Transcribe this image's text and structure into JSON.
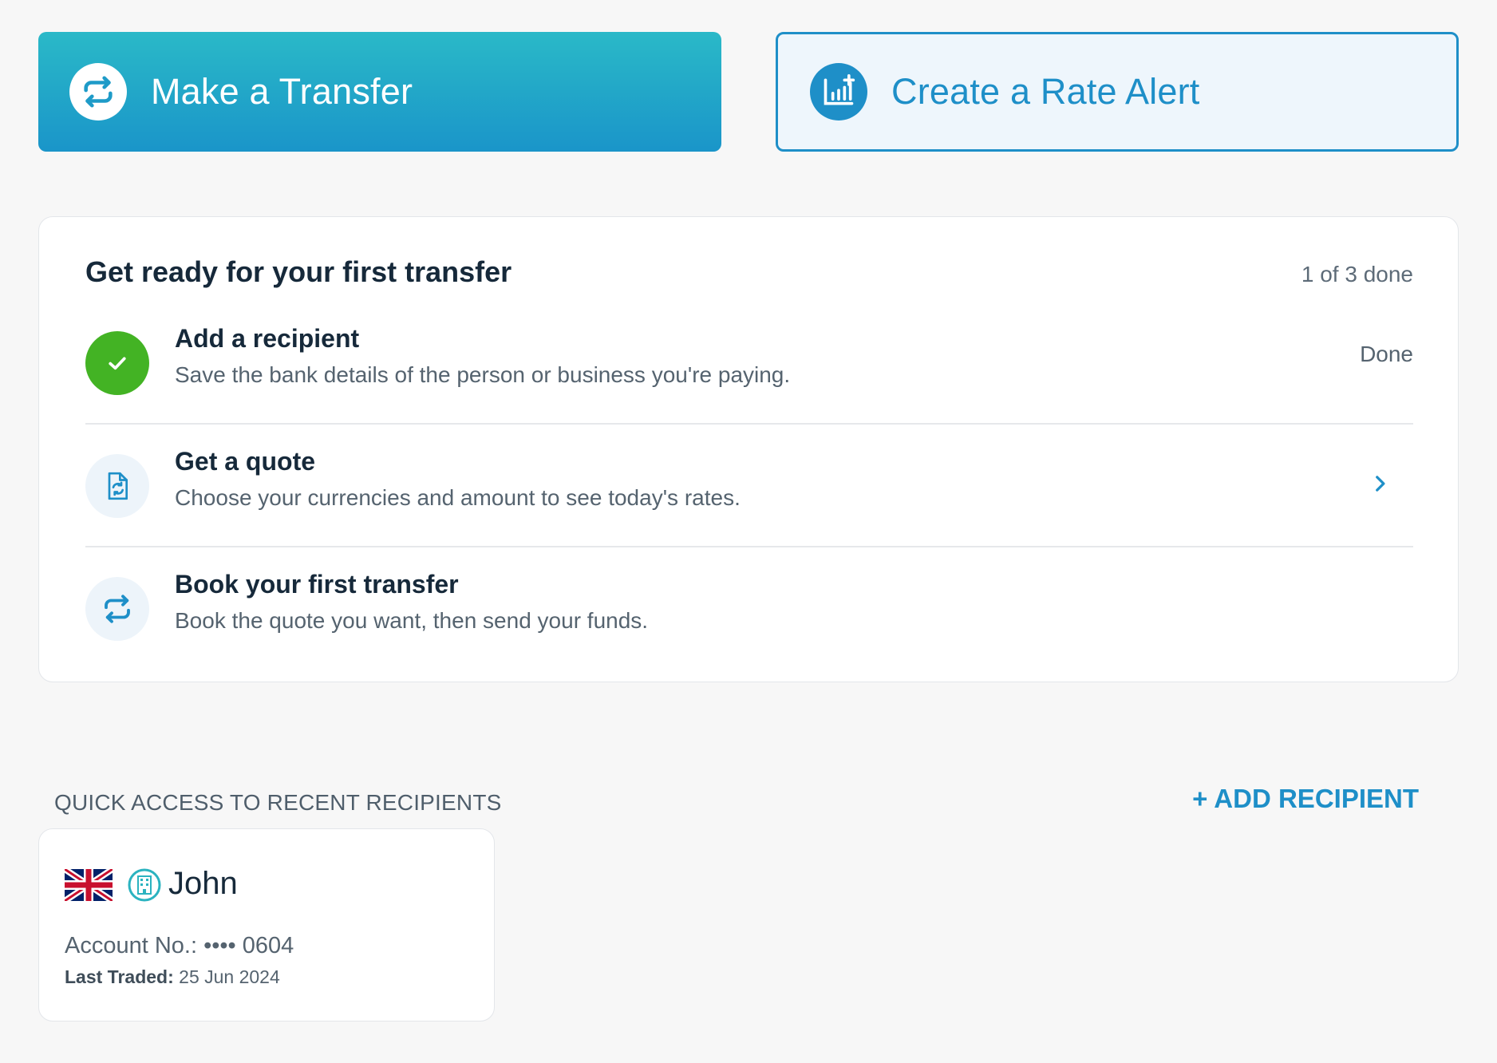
{
  "actions": {
    "transfer_label": "Make a Transfer",
    "rate_alert_label": "Create a Rate Alert"
  },
  "checklist": {
    "title": "Get ready for your first transfer",
    "progress": "1 of 3 done",
    "steps": [
      {
        "title": "Add a recipient",
        "description": "Save the bank details of the person or business you're paying.",
        "status": "Done",
        "icon": "check-icon"
      },
      {
        "title": "Get a quote",
        "description": "Choose your currencies and amount to see today's rates.",
        "icon": "quote-document-icon"
      },
      {
        "title": "Book your first transfer",
        "description": "Book the quote you want, then send your funds.",
        "icon": "transfer-arrows-icon"
      }
    ]
  },
  "recipients": {
    "section_label": "QUICK ACCESS TO RECENT RECIPIENTS",
    "add_label": "+ ADD RECIPIENT",
    "items": [
      {
        "name": "John",
        "flag": "uk-flag-icon",
        "type_icon": "bank-building-icon",
        "account_label": "Account No.:",
        "account_masked": "•••• 0604",
        "last_traded_label": "Last Traded:",
        "last_traded_date": "25 Jun 2024"
      }
    ]
  },
  "colors": {
    "primary": "#1e8fc8",
    "teal": "#2ab9c8",
    "success": "#43b324",
    "text_dark": "#16293a",
    "text_muted": "#55636f"
  }
}
